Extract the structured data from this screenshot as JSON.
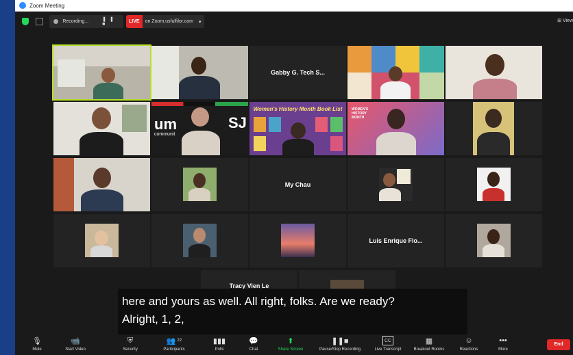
{
  "window": {
    "title": "Zoom Meeting"
  },
  "topbar": {
    "recording_label": "Recording...",
    "live_badge": "LIVE",
    "live_label": "on Zoom.usfulfilor.com",
    "view_label": "View"
  },
  "participants": [
    {
      "id": "p1",
      "name": "",
      "active": true
    },
    {
      "id": "p2",
      "name": ""
    },
    {
      "id": "p3",
      "name": "Gabby G. Tech S..."
    },
    {
      "id": "p4",
      "name": ""
    },
    {
      "id": "p5",
      "name": ""
    },
    {
      "id": "p6",
      "name": ""
    },
    {
      "id": "p7",
      "name": "",
      "virtual_bg_text": "um",
      "virtual_bg_text2": "communit",
      "virtual_bg_text3": "SJ"
    },
    {
      "id": "p8",
      "name": "",
      "virtual_bg_text": "Women's History Month Book List"
    },
    {
      "id": "p9",
      "name": "",
      "virtual_bg_text": "WOMEN'S HISTORY MONTH"
    },
    {
      "id": "p10",
      "name": ""
    },
    {
      "id": "p11",
      "name": ""
    },
    {
      "id": "p12",
      "name": ""
    },
    {
      "id": "p13",
      "name": "My Chau"
    },
    {
      "id": "p14",
      "name": ""
    },
    {
      "id": "p15",
      "name": ""
    },
    {
      "id": "p16",
      "name": ""
    },
    {
      "id": "p17",
      "name": ""
    },
    {
      "id": "p18",
      "name": ""
    },
    {
      "id": "p19",
      "name": "Luis Enrique Flo..."
    },
    {
      "id": "p20",
      "name": ""
    },
    {
      "id": "p21",
      "name": "Tracy Vien Le"
    },
    {
      "id": "p22",
      "name": ""
    }
  ],
  "caption": {
    "line1": "here and yours as well. All right, folks. Are we ready?",
    "line2": "Alright, 1, 2,"
  },
  "toolbar": {
    "mute": "Mute",
    "start_video": "Start Video",
    "security": "Security",
    "participants": "Participants",
    "participants_count": "22",
    "polls": "Polls",
    "chat": "Chat",
    "share_screen": "Share Screen",
    "pause_stop_recording": "Pause/Stop Recording",
    "live_transcript": "Live Transcript",
    "breakout_rooms": "Breakout Rooms",
    "reactions": "Reactions",
    "more": "More",
    "end": "End",
    "cc_icon_text": "CC"
  },
  "colors": {
    "accent_green": "#23d959",
    "live_red": "#e02828",
    "active_speaker": "#b6e02a",
    "zoom_blue": "#2d8cff"
  }
}
